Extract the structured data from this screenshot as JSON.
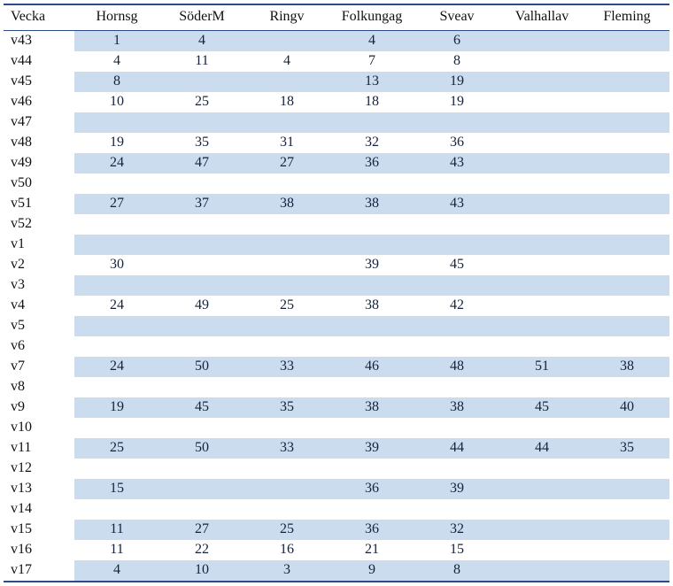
{
  "headers": [
    "Vecka",
    "Hornsg",
    "SöderM",
    "Ringv",
    "Folkungag",
    "Sveav",
    "Valhallav",
    "Fleming"
  ],
  "rows": [
    {
      "week": "v43",
      "cells": [
        "1",
        "4",
        "",
        "4",
        "6",
        "",
        ""
      ]
    },
    {
      "week": "v44",
      "cells": [
        "4",
        "11",
        "4",
        "7",
        "8",
        "",
        ""
      ]
    },
    {
      "week": "v45",
      "cells": [
        "8",
        "",
        "",
        "13",
        "19",
        "",
        ""
      ]
    },
    {
      "week": "v46",
      "cells": [
        "10",
        "25",
        "18",
        "18",
        "19",
        "",
        ""
      ]
    },
    {
      "week": "v47",
      "cells": [
        "",
        "",
        "",
        "",
        "",
        "",
        ""
      ]
    },
    {
      "week": "v48",
      "cells": [
        "19",
        "35",
        "31",
        "32",
        "36",
        "",
        ""
      ]
    },
    {
      "week": "v49",
      "cells": [
        "24",
        "47",
        "27",
        "36",
        "43",
        "",
        ""
      ]
    },
    {
      "week": "v50",
      "cells": [
        "",
        "",
        "",
        "",
        "",
        "",
        ""
      ]
    },
    {
      "week": "v51",
      "cells": [
        "27",
        "37",
        "38",
        "38",
        "43",
        "",
        ""
      ]
    },
    {
      "week": "v52",
      "cells": [
        "",
        "",
        "",
        "",
        "",
        "",
        ""
      ]
    },
    {
      "week": "v1",
      "cells": [
        "",
        "",
        "",
        "",
        "",
        "",
        ""
      ]
    },
    {
      "week": "v2",
      "cells": [
        "30",
        "",
        "",
        "39",
        "45",
        "",
        ""
      ]
    },
    {
      "week": "v3",
      "cells": [
        "",
        "",
        "",
        "",
        "",
        "",
        ""
      ]
    },
    {
      "week": "v4",
      "cells": [
        "24",
        "49",
        "25",
        "38",
        "42",
        "",
        ""
      ]
    },
    {
      "week": "v5",
      "cells": [
        "",
        "",
        "",
        "",
        "",
        "",
        ""
      ]
    },
    {
      "week": "v6",
      "cells": [
        "",
        "",
        "",
        "",
        "",
        "",
        ""
      ]
    },
    {
      "week": "v7",
      "cells": [
        "24",
        "50",
        "33",
        "46",
        "48",
        "51",
        "38"
      ]
    },
    {
      "week": "v8",
      "cells": [
        "",
        "",
        "",
        "",
        "",
        "",
        ""
      ]
    },
    {
      "week": "v9",
      "cells": [
        "19",
        "45",
        "35",
        "38",
        "38",
        "45",
        "40"
      ]
    },
    {
      "week": "v10",
      "cells": [
        "",
        "",
        "",
        "",
        "",
        "",
        ""
      ]
    },
    {
      "week": "v11",
      "cells": [
        "25",
        "50",
        "33",
        "39",
        "44",
        "44",
        "35"
      ]
    },
    {
      "week": "v12",
      "cells": [
        "",
        "",
        "",
        "",
        "",
        "",
        ""
      ]
    },
    {
      "week": "v13",
      "cells": [
        "15",
        "",
        "",
        "36",
        "39",
        "",
        ""
      ]
    },
    {
      "week": "v14",
      "cells": [
        "",
        "",
        "",
        "",
        "",
        "",
        ""
      ]
    },
    {
      "week": "v15",
      "cells": [
        "11",
        "27",
        "25",
        "36",
        "32",
        "",
        ""
      ]
    },
    {
      "week": "v16",
      "cells": [
        "11",
        "22",
        "16",
        "21",
        "15",
        "",
        ""
      ]
    },
    {
      "week": "v17",
      "cells": [
        "4",
        "10",
        "3",
        "9",
        "8",
        "",
        ""
      ]
    }
  ]
}
